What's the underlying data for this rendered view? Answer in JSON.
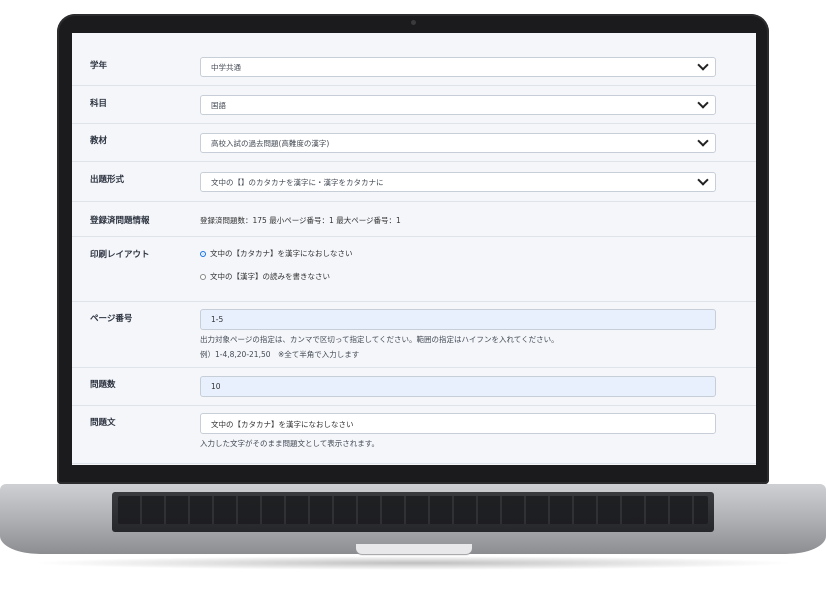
{
  "form": {
    "grade": {
      "label": "学年",
      "value": "中学共通"
    },
    "subject": {
      "label": "科目",
      "value": "国語"
    },
    "material": {
      "label": "教材",
      "value": "高校入試の過去問題(高難度の漢字)"
    },
    "format": {
      "label": "出題形式",
      "value": "文中の【】のカタカナを漢字に・漢字をカタカナに"
    },
    "registered": {
      "label": "登録済問題情報",
      "value": "登録済問題数：175 最小ページ番号：1 最大ページ番号：1"
    },
    "layout": {
      "label": "印刷レイアウト",
      "options": [
        {
          "text": "文中の【カタカナ】を漢字になおしなさい",
          "selected": true
        },
        {
          "text": "文中の【漢字】の読みを書きなさい",
          "selected": false
        }
      ]
    },
    "page": {
      "label": "ページ番号",
      "value": "1-5",
      "help1": "出力対象ページの指定は、カンマで区切って指定してください。範囲の指定はハイフンを入れてください。",
      "help2": "例）1-4,8,20-21,50　※全て半角で入力します"
    },
    "count": {
      "label": "問題数",
      "value": "10"
    },
    "question": {
      "label": "問題文",
      "value": "文中の【カタカナ】を漢字になおしなさい",
      "help": "入力した文字がそのまま問題文として表示されます。"
    }
  },
  "colors": {
    "selected_radio": "#1a73e8",
    "filled_input": "#e8f0fe"
  }
}
